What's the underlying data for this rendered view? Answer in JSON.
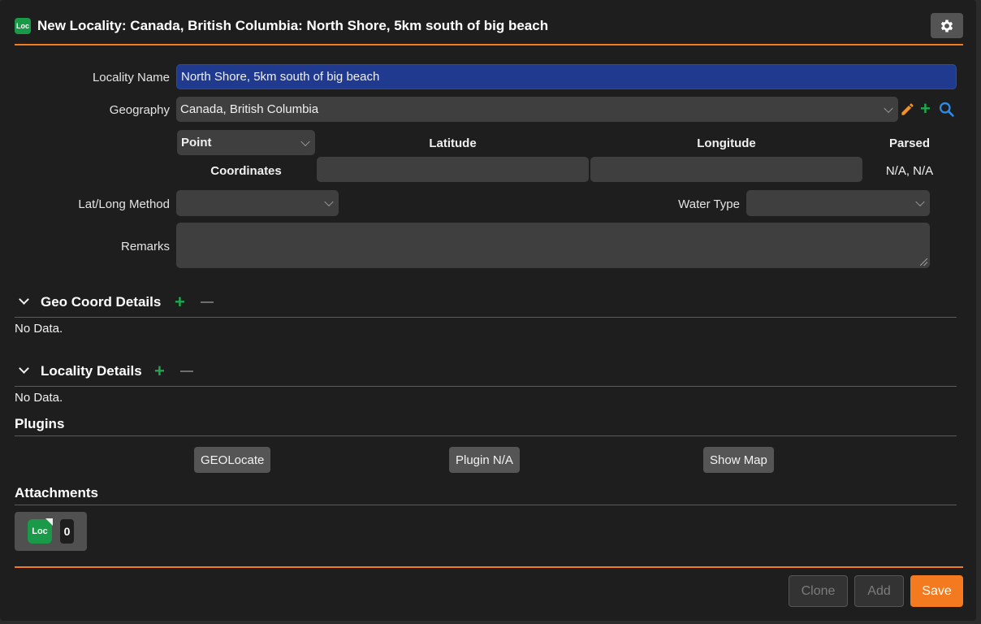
{
  "header": {
    "icon_text": "Loc",
    "title": "New Locality: Canada, British Columbia: North Shore, 5km south of big beach"
  },
  "form": {
    "locality_name_label": "Locality Name",
    "locality_name_value": "North Shore, 5km south of big beach",
    "geography_label": "Geography",
    "geography_value": "Canada, British Columbia",
    "coord_type_value": "Point",
    "latitude_header": "Latitude",
    "longitude_header": "Longitude",
    "parsed_header": "Parsed",
    "coordinates_label": "Coordinates",
    "latitude_value": "",
    "longitude_value": "",
    "parsed_value": "N/A, N/A",
    "latlong_method_label": "Lat/Long Method",
    "latlong_method_value": "",
    "water_type_label": "Water Type",
    "water_type_value": "",
    "remarks_label": "Remarks",
    "remarks_value": ""
  },
  "sections": {
    "geo_coord": {
      "title": "Geo Coord Details",
      "empty": "No Data."
    },
    "locality_details": {
      "title": "Locality Details",
      "empty": "No Data."
    },
    "plugins": {
      "title": "Plugins",
      "buttons": [
        "GEOLocate",
        "Plugin N/A",
        "Show Map"
      ]
    },
    "attachments": {
      "title": "Attachments",
      "icon_text": "Loc",
      "count": "0"
    }
  },
  "footer": {
    "clone_label": "Clone",
    "add_label": "Add",
    "save_label": "Save"
  },
  "colors": {
    "accent": "#f47a1f",
    "brand_green": "#1a9a48",
    "active_field": "#1f3a8f"
  }
}
